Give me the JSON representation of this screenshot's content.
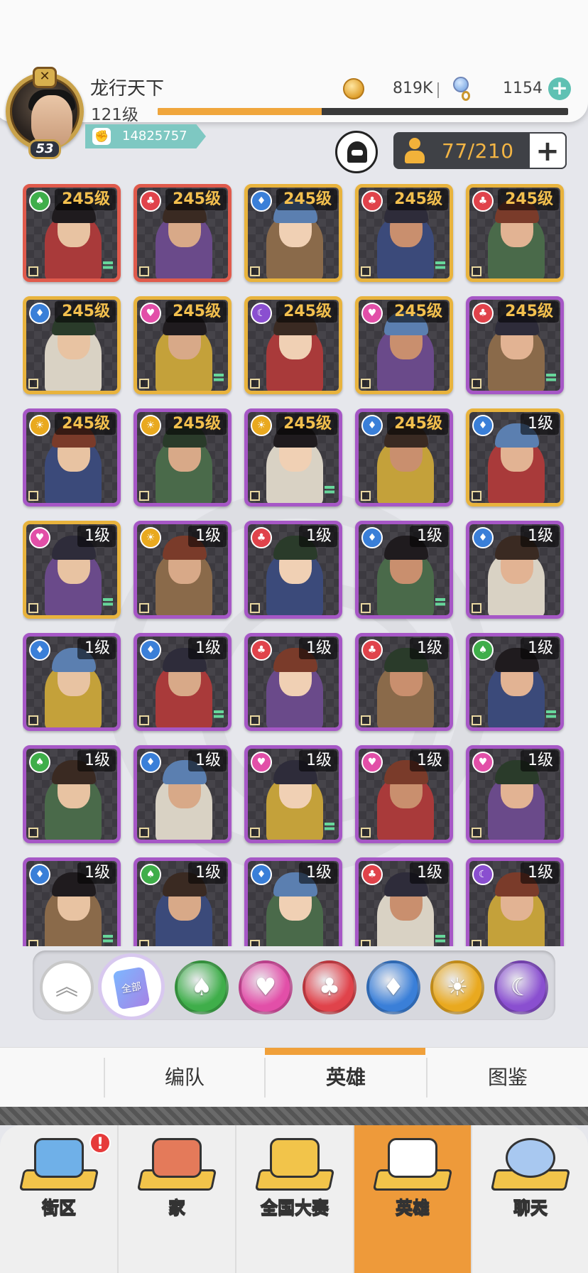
{
  "header": {
    "player_name": "龙行天下",
    "player_level": "121级",
    "xp_fraction": 0.4,
    "avatar_level": "53",
    "power": "14825757",
    "coins": "819K",
    "gems": "1154"
  },
  "roster": {
    "count": "77/210"
  },
  "heroes": [
    {
      "level": "245级",
      "faction": "spade",
      "rarity": "red"
    },
    {
      "level": "245级",
      "faction": "club",
      "rarity": "red"
    },
    {
      "level": "245级",
      "faction": "diamond",
      "rarity": "gold"
    },
    {
      "level": "245级",
      "faction": "club",
      "rarity": "gold"
    },
    {
      "level": "245级",
      "faction": "club",
      "rarity": "gold"
    },
    {
      "level": "245级",
      "faction": "diamond",
      "rarity": "gold"
    },
    {
      "level": "245级",
      "faction": "heart",
      "rarity": "gold"
    },
    {
      "level": "245级",
      "faction": "moon",
      "rarity": "gold"
    },
    {
      "level": "245级",
      "faction": "heart",
      "rarity": "gold"
    },
    {
      "level": "245级",
      "faction": "club",
      "rarity": "purple"
    },
    {
      "level": "245级",
      "faction": "sun",
      "rarity": "purple"
    },
    {
      "level": "245级",
      "faction": "sun",
      "rarity": "purple"
    },
    {
      "level": "245级",
      "faction": "sun",
      "rarity": "purple"
    },
    {
      "level": "245级",
      "faction": "diamond",
      "rarity": "purple"
    },
    {
      "level": "1级",
      "faction": "diamond",
      "rarity": "gold"
    },
    {
      "level": "1级",
      "faction": "heart",
      "rarity": "gold"
    },
    {
      "level": "1级",
      "faction": "sun",
      "rarity": "purple"
    },
    {
      "level": "1级",
      "faction": "club",
      "rarity": "purple"
    },
    {
      "level": "1级",
      "faction": "diamond",
      "rarity": "purple"
    },
    {
      "level": "1级",
      "faction": "diamond",
      "rarity": "purple"
    },
    {
      "level": "1级",
      "faction": "diamond",
      "rarity": "purple"
    },
    {
      "level": "1级",
      "faction": "diamond",
      "rarity": "purple"
    },
    {
      "level": "1级",
      "faction": "club",
      "rarity": "purple"
    },
    {
      "level": "1级",
      "faction": "club",
      "rarity": "purple"
    },
    {
      "level": "1级",
      "faction": "spade",
      "rarity": "purple"
    },
    {
      "level": "1级",
      "faction": "spade",
      "rarity": "purple"
    },
    {
      "level": "1级",
      "faction": "diamond",
      "rarity": "purple"
    },
    {
      "level": "1级",
      "faction": "heart",
      "rarity": "purple"
    },
    {
      "level": "1级",
      "faction": "heart",
      "rarity": "purple"
    },
    {
      "level": "1级",
      "faction": "heart",
      "rarity": "purple"
    },
    {
      "level": "1级",
      "faction": "diamond",
      "rarity": "purple"
    },
    {
      "level": "1级",
      "faction": "spade",
      "rarity": "purple"
    },
    {
      "level": "1级",
      "faction": "diamond",
      "rarity": "purple"
    },
    {
      "level": "1级",
      "faction": "club",
      "rarity": "purple"
    },
    {
      "level": "1级",
      "faction": "moon",
      "rarity": "purple"
    }
  ],
  "faction_colors": {
    "spade": "#3fae4a",
    "heart": "#e24fa8",
    "club": "#e0434b",
    "diamond": "#3a7fd8",
    "sun": "#e9a91f",
    "moon": "#8a4fd0"
  },
  "filters": {
    "all_label": "全部",
    "items": [
      "spade",
      "heart",
      "club",
      "diamond",
      "sun",
      "moon"
    ]
  },
  "subtabs": [
    "编队",
    "英雄",
    "图鉴"
  ],
  "active_subtab": "英雄",
  "bottom_nav": [
    {
      "label": "街区",
      "icon": "street-sign-icon",
      "alert": "!"
    },
    {
      "label": "家",
      "icon": "house-icon"
    },
    {
      "label": "全国大赛",
      "icon": "trophy-icon"
    },
    {
      "label": "英雄",
      "icon": "hero-cards-icon",
      "active": true
    },
    {
      "label": "聊天",
      "icon": "chat-bubble-icon"
    }
  ]
}
